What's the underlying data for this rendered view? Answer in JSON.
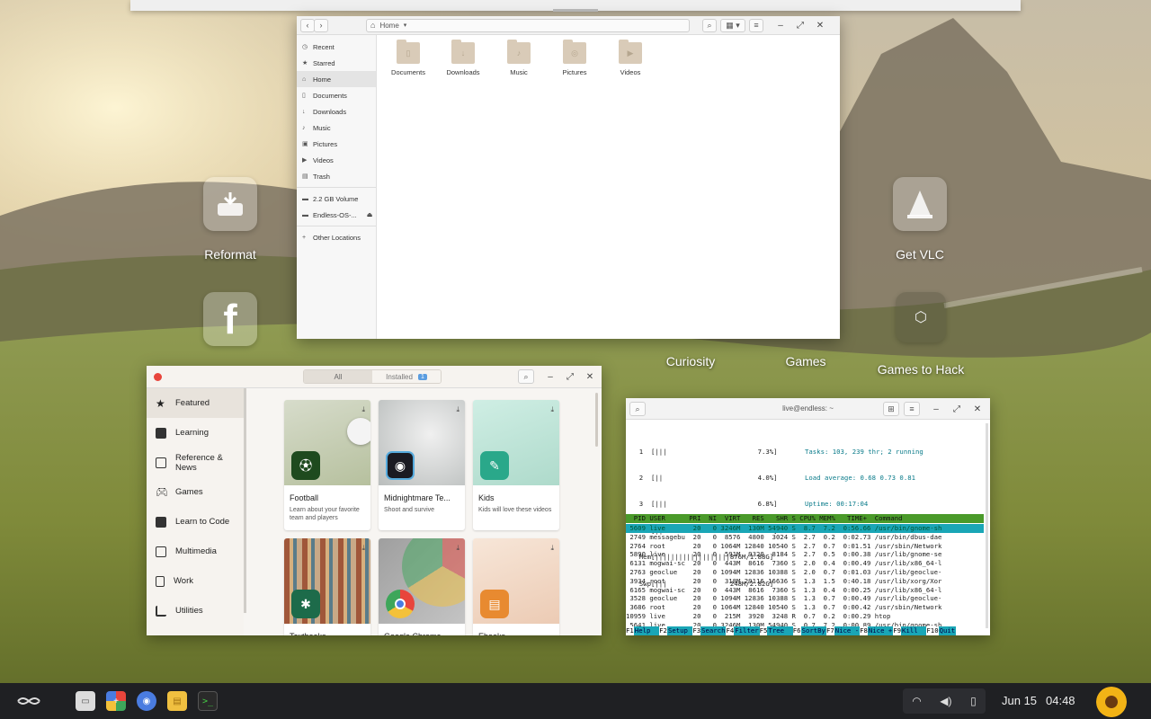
{
  "desktop": {
    "icons": [
      {
        "label": "Reformat",
        "icon": "disk-icon"
      },
      {
        "label": "Get VLC",
        "icon": "vlc-cone-icon"
      },
      {
        "label": "Curiosity",
        "icon": "curiosity-icon"
      },
      {
        "label": "Games",
        "icon": "games-folder-icon"
      },
      {
        "label": "Games to Hack",
        "icon": "unity-icon"
      }
    ]
  },
  "files": {
    "path": "Home",
    "sidebar": [
      {
        "label": "Recent",
        "icon": "clock-icon"
      },
      {
        "label": "Starred",
        "icon": "star-icon"
      },
      {
        "label": "Home",
        "icon": "home-icon",
        "active": true
      },
      {
        "label": "Documents",
        "icon": "document-icon"
      },
      {
        "label": "Downloads",
        "icon": "download-icon"
      },
      {
        "label": "Music",
        "icon": "music-icon"
      },
      {
        "label": "Pictures",
        "icon": "picture-icon"
      },
      {
        "label": "Videos",
        "icon": "video-icon"
      },
      {
        "label": "Trash",
        "icon": "trash-icon"
      },
      {
        "label": "2.2 GB Volume",
        "icon": "drive-icon"
      },
      {
        "label": "Endless-OS-...",
        "icon": "drive-icon"
      },
      {
        "label": "Other Locations",
        "icon": "plus-icon"
      }
    ],
    "folders": [
      "Documents",
      "Downloads",
      "Music",
      "Pictures",
      "Videos"
    ]
  },
  "software": {
    "tabs": {
      "all": "All",
      "installed": "Installed",
      "installed_count": "1"
    },
    "sidebar": [
      {
        "label": "Featured",
        "active": true
      },
      {
        "label": "Learning"
      },
      {
        "label": "Reference & News"
      },
      {
        "label": "Games"
      },
      {
        "label": "Learn to Code"
      },
      {
        "label": "Multimedia"
      },
      {
        "label": "Work"
      },
      {
        "label": "Utilities"
      }
    ],
    "cards": [
      {
        "title": "Football",
        "desc": "Learn about your favorite team and players",
        "bg": "#c9d3b8",
        "icon_bg": "#1e4a1e"
      },
      {
        "title": "Midnightmare Te...",
        "desc": "Shoot and survive",
        "bg": "#d8dbd8",
        "icon_bg": "#1a1a22"
      },
      {
        "title": "Kids",
        "desc": "Kids will love these videos",
        "bg": "#bfe3d8",
        "icon_bg": "#2aa88a"
      },
      {
        "title": "Textbooks",
        "desc": "",
        "bg": "#c9a987",
        "icon_bg": "#1d6b4a"
      },
      {
        "title": "Google Chrome",
        "desc": "",
        "bg": "#a8a8a8",
        "icon_bg": "#ffffff"
      },
      {
        "title": "Ebooks",
        "desc": "",
        "bg": "#f1d6c4",
        "icon_bg": "#e88a30"
      }
    ]
  },
  "terminal": {
    "title": "live@endless: ~",
    "cpu_lines": [
      "  1  [|||                       7.3%]",
      "  2  [||                        4.0%]",
      "  3  [|||                       6.8%]",
      "  4  [||                        3.4%]",
      "  Mem[|||||||||||||||||||876M/1.88G]",
      "  Swp[|||                248M/2.82G]"
    ],
    "stats": [
      "Tasks: 103, 239 thr; 2 running",
      "Load average: 0.68 0.73 0.81",
      "Uptime: 00:17:04"
    ],
    "header": "  PID USER      PRI  NI  VIRT   RES   SHR S CPU% MEM%   TIME+  Command",
    "rows": [
      " 5609 live       20   0 3246M  130M 54940 S  8.7  7.2  0:56.66 /usr/bin/gnome-sh",
      " 2749 messagebu  20   0  8576  4800  3024 S  2.7  0.2  0:02.73 /usr/bin/dbus-dae",
      " 2764 root       20   0 1064M 12840 10540 S  2.7  0.7  0:01.51 /usr/sbin/Network",
      " 5890 live       20   0  591M  9320  8184 S  2.7  0.5  0:00.38 /usr/lib/gnome-se",
      " 6131 mogwai-sc  20   0  443M  8616  7360 S  2.0  0.4  0:00.49 /usr/lib/x86_64-l",
      " 2763 geoclue    20   0 1094M 12836 10388 S  2.0  0.7  0:01.03 /usr/lib/geoclue-",
      " 3934 root       20   0  318M 29116 16636 S  1.3  1.5  0:40.18 /usr/lib/xorg/Xor",
      " 6165 mogwai-sc  20   0  443M  8616  7360 S  1.3  0.4  0:00.25 /usr/lib/x86_64-l",
      " 3528 geoclue    20   0 1094M 12836 10388 S  1.3  0.7  0:00.49 /usr/lib/geoclue-",
      " 3686 root       20   0 1064M 12840 10540 S  1.3  0.7  0:00.42 /usr/sbin/Network",
      "10959 live       20   0  215M  3920  3248 R  0.7  0.2  0:00.29 htop",
      " 5641 live       20   0 3246M  130M 54940 S  0.7  7.2  0:00.89 /usr/bin/gnome-sh",
      " 5978 live       20   0  591M  9320  8184 S  0.7  0.5  0:00.21 /usr/lib/gnome-se",
      " 4032 root       20   0  318M 29116 16636 S  0.7  1.5  0:02.53 /usr/lib/xorg/Xor"
    ],
    "fkeys": [
      {
        "k": "F1",
        "l": "Help  "
      },
      {
        "k": "F2",
        "l": "Setup "
      },
      {
        "k": "F3",
        "l": "Search"
      },
      {
        "k": "F4",
        "l": "Filter"
      },
      {
        "k": "F5",
        "l": "Tree  "
      },
      {
        "k": "F6",
        "l": "SortBy"
      },
      {
        "k": "F7",
        "l": "Nice -"
      },
      {
        "k": "F8",
        "l": "Nice +"
      },
      {
        "k": "F9",
        "l": "Kill  "
      },
      {
        "k": "F10",
        "l": "Quit"
      }
    ]
  },
  "taskbar": {
    "apps": [
      {
        "name": "files-manager-icon",
        "color": "#dcdcdc"
      },
      {
        "name": "app-center-icon",
        "color": "#e8453c"
      },
      {
        "name": "chromium-icon",
        "color": "#4a7ce0"
      },
      {
        "name": "folder-icon",
        "color": "#f0c040"
      },
      {
        "name": "terminal-icon",
        "color": "#2a2a2a"
      }
    ],
    "date": "Jun 15",
    "time": "04:48"
  }
}
